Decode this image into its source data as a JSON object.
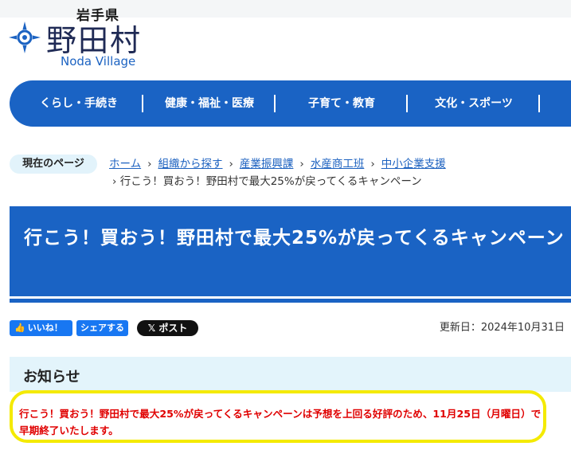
{
  "header": {
    "prefecture": "岩手県",
    "village_name": "野田村",
    "village_roman": "Noda Village",
    "emblem_icon": "village-emblem-icon"
  },
  "global_nav": {
    "items": [
      {
        "label": "くらし・手続き"
      },
      {
        "label": "健康・福祉・医療"
      },
      {
        "label": "子育て・教育"
      },
      {
        "label": "文化・スポーツ"
      }
    ]
  },
  "breadcrumb": {
    "label": "現在のページ",
    "links": [
      "ホーム",
      "組織から探す",
      "産業振興課",
      "水産商工班",
      "中小企業支援"
    ],
    "current": "行こう！買おう！野田村で最大25%が戻ってくるキャンペーン"
  },
  "article": {
    "title": "行こう！買おう！野田村で最大25%が戻ってくるキャンペーン",
    "updated": "更新日：2024年10月31日"
  },
  "social": {
    "like_label": "いいね！",
    "share_label": "シェアする",
    "post_label": "𝕏 ポスト"
  },
  "notice": {
    "heading": "お知らせ",
    "text": "行こう！買おう！野田村で最大25%が戻ってくるキャンペーンは予想を上回る好評のため、11月25日（月曜日）で早期終了いたします。"
  },
  "colors": {
    "brand_blue": "#1a63c4",
    "notice_red": "#e00000",
    "highlight_yellow": "#f4ea00",
    "light_blue": "#e3f4fb"
  }
}
